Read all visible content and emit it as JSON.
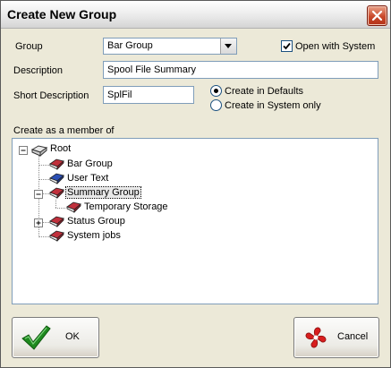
{
  "window": {
    "title": "Create New Group"
  },
  "form": {
    "group_label": "Group",
    "group_value": "Bar Group",
    "open_with_system_label": "Open with System",
    "open_with_system_checked": true,
    "description_label": "Description",
    "description_value": "Spool File Summary",
    "short_description_label": "Short Description",
    "short_description_value": "SplFil",
    "create_in_defaults_label": "Create in Defaults",
    "create_in_system_only_label": "Create in System only",
    "create_in_selected": "defaults"
  },
  "tree": {
    "heading": "Create as a member of",
    "items": [
      {
        "label": "Root",
        "icon": "root-folder-icon",
        "expander": "minus"
      },
      {
        "label": "Bar Group",
        "icon": "red-book-icon"
      },
      {
        "label": "User Text",
        "icon": "blue-book-icon"
      },
      {
        "label": "Summary Group",
        "icon": "red-book-icon",
        "expander": "minus",
        "selected": true
      },
      {
        "label": "Temporary Storage",
        "icon": "red-book-icon"
      },
      {
        "label": "Status Group",
        "icon": "red-book-icon",
        "expander": "plus"
      },
      {
        "label": "System jobs",
        "icon": "red-book-icon"
      }
    ]
  },
  "buttons": {
    "ok_label": "OK",
    "cancel_label": "Cancel"
  },
  "colors": {
    "ok_check": "#1f8a1f",
    "cancel_icon": "#d81e1e",
    "red_book": "#c0303c",
    "blue_book": "#2b4fb5"
  }
}
